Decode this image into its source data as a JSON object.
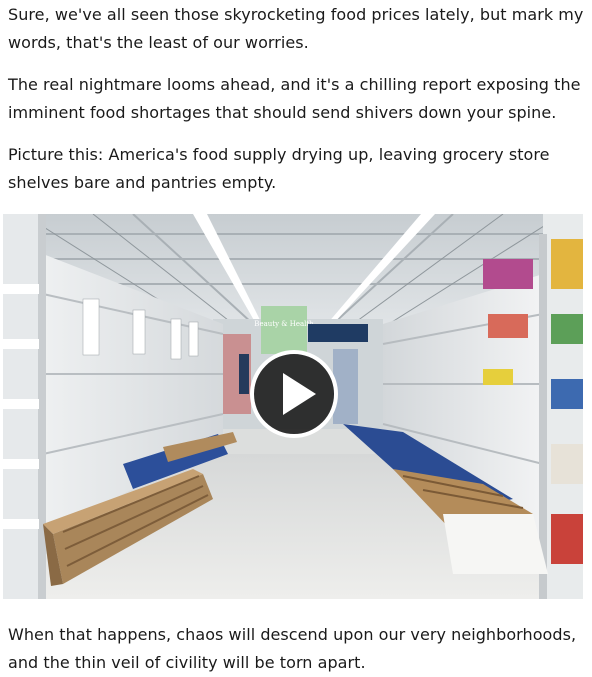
{
  "article": {
    "paragraphs": [
      "Sure, we've all seen those skyrocketing food prices lately, but mark my words, that's the least of our worries.",
      "The real nightmare looms ahead, and it's a chilling report exposing the imminent food shortages that should send shivers down your spine.",
      "Picture this: America's food supply drying up, leaving grocery store shelves bare and pantries empty.",
      "When that happens, chaos will descend upon our very neighborhoods, and the thin veil of civility will be torn apart."
    ]
  },
  "video": {
    "play_icon": "play-icon",
    "store_sign_text": "Beauty & Health",
    "colors": {
      "overlay": "#0a0a0a",
      "play_ring": "#ffffff",
      "floor": "#e4e4e2",
      "pallet_wood": "#b48c5a",
      "pallet_blue": "#2e4f96"
    }
  }
}
